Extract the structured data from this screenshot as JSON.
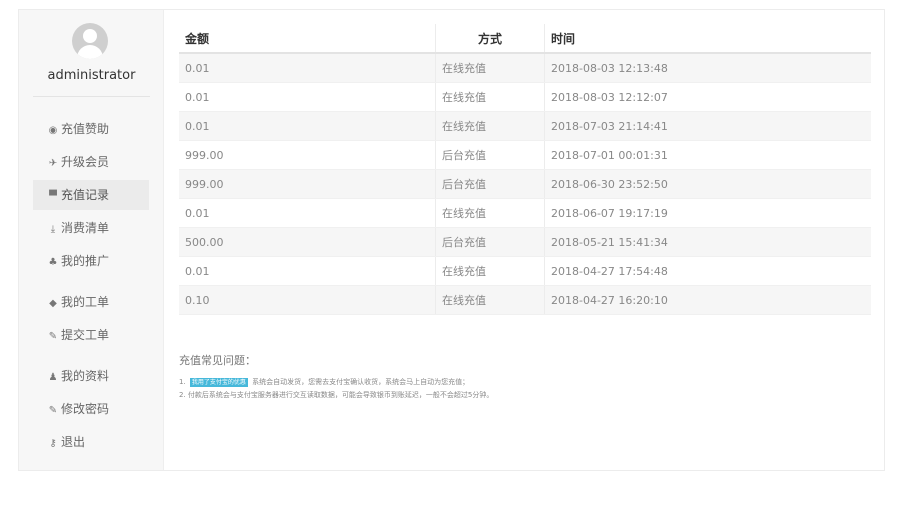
{
  "user": {
    "name": "administrator"
  },
  "menu": [
    {
      "icon": "globe-icon",
      "glyph": "◉",
      "label": "充值赞助",
      "active": false
    },
    {
      "icon": "plane-icon",
      "glyph": "✈",
      "label": "升级会员",
      "active": false
    },
    {
      "icon": "cart-icon",
      "glyph": "▀",
      "label": "充值记录",
      "active": true
    },
    {
      "icon": "download-icon",
      "glyph": "⤓",
      "label": "消费清单",
      "active": false
    },
    {
      "icon": "sitemap-icon",
      "glyph": "♣",
      "label": "我的推广",
      "active": false
    },
    {
      "icon": "ticket-icon",
      "glyph": "◆",
      "label": "我的工单",
      "active": false
    },
    {
      "icon": "edit-icon",
      "glyph": "✎",
      "label": "提交工单",
      "active": false
    },
    {
      "icon": "users-icon",
      "glyph": "♟",
      "label": "我的资料",
      "active": false
    },
    {
      "icon": "edit-icon",
      "glyph": "✎",
      "label": "修改密码",
      "active": false
    },
    {
      "icon": "key-icon",
      "glyph": "⚷",
      "label": "退出",
      "active": false
    }
  ],
  "table": {
    "headers": [
      "金额",
      "方式",
      "时间"
    ],
    "rows": [
      [
        "0.01",
        "在线充值",
        "2018-08-03 12:13:48"
      ],
      [
        "0.01",
        "在线充值",
        "2018-08-03 12:12:07"
      ],
      [
        "0.01",
        "在线充值",
        "2018-07-03 21:14:41"
      ],
      [
        "999.00",
        "后台充值",
        "2018-07-01 00:01:31"
      ],
      [
        "999.00",
        "后台充值",
        "2018-06-30 23:52:50"
      ],
      [
        "0.01",
        "在线充值",
        "2018-06-07 19:17:19"
      ],
      [
        "500.00",
        "后台充值",
        "2018-05-21 15:41:34"
      ],
      [
        "0.01",
        "在线充值",
        "2018-04-27 17:54:48"
      ],
      [
        "0.10",
        "在线充值",
        "2018-04-27 16:20:10"
      ]
    ]
  },
  "faq": {
    "title": "充值常见问题：",
    "line1_prefix": "1.",
    "line1_tag": "我用了支付宝的优惠",
    "line1_text": "系统会自动发货，您需去支付宝确认收货，系统会马上自动为您充值；",
    "line2": "2. 付款后系统会与支付宝服务器进行交互读取数据，可能会导致银币到账延迟，一般不会超过5分钟。"
  },
  "colors": {
    "tag_bg": "#46b8da",
    "active_menu": "#ebebeb"
  }
}
